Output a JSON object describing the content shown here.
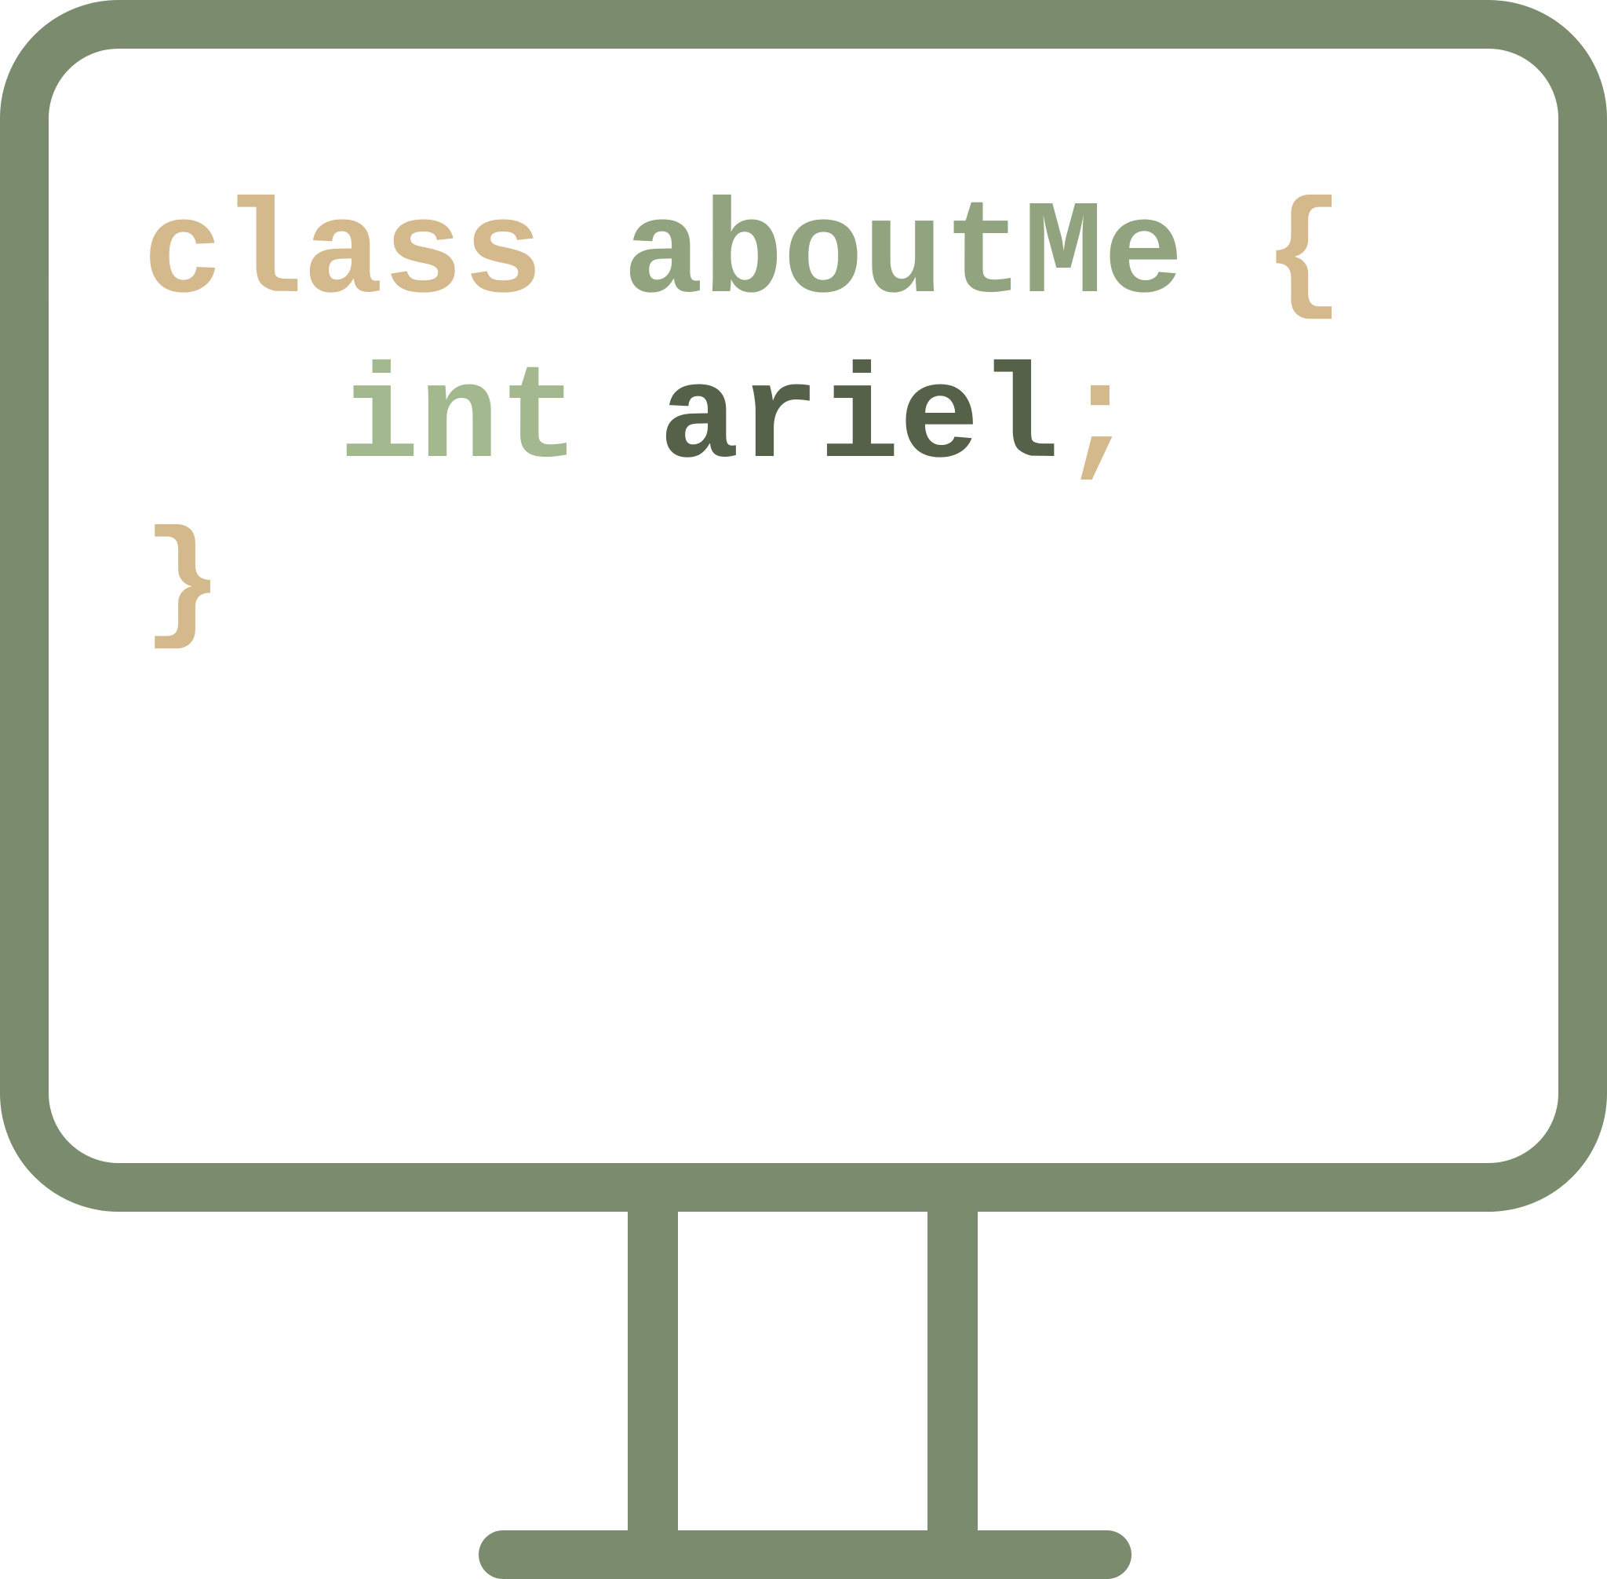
{
  "code": {
    "line1": {
      "keyword": "class",
      "name": "aboutMe",
      "brace_open": "{"
    },
    "line2": {
      "type": "int",
      "identifier": "ariel",
      "semicolon": ";"
    },
    "line3": {
      "brace_close": "}"
    }
  },
  "colors": {
    "frame": "#7b8b6d",
    "keyword": "#d4b98c",
    "name": "#92a47f",
    "type": "#a3b88e",
    "identifier": "#556148",
    "punctuation": "#d4b98c"
  }
}
